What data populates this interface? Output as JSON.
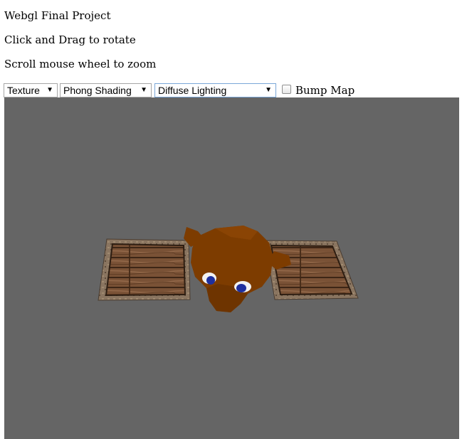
{
  "header": {
    "title": "Webgl Final Project",
    "instruction_rotate": "Click and Drag to rotate",
    "instruction_zoom": "Scroll mouse wheel to zoom"
  },
  "controls": {
    "material_select": {
      "value": "Texture"
    },
    "shading_select": {
      "value": "Phong Shading"
    },
    "lighting_select": {
      "value": "Diffuse Lighting"
    },
    "bump_map": {
      "label": "Bump Map",
      "checked": false
    }
  },
  "scene": {
    "background_color": "#656565",
    "objects": [
      "wooden-crate-left",
      "monkey-head",
      "wooden-crate-right"
    ],
    "colors": {
      "monkey": "#7d3c00",
      "crate_frame": "#8a7560",
      "crate_planks": "#7a5236",
      "eye_white": "#f2f2f2",
      "eye_iris": "#1e2f9e"
    }
  }
}
